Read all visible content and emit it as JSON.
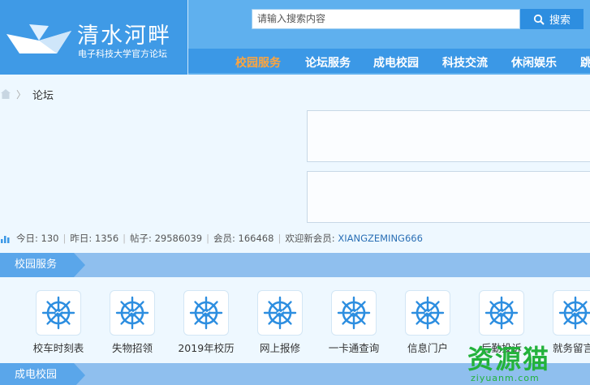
{
  "header": {
    "site_title": "清水河畔",
    "site_subtitle": "电子科技大学官方论坛",
    "search_placeholder": "请输入搜索内容",
    "search_button": "搜索"
  },
  "nav": {
    "items": [
      "校园服务",
      "论坛服务",
      "成电校园",
      "科技交流",
      "休闲娱乐",
      "跳"
    ],
    "active_index": 0
  },
  "breadcrumb": {
    "current": "论坛"
  },
  "stats": {
    "today_label": "今日:",
    "today": "130",
    "yesterday_label": "昨日:",
    "yesterday": "1356",
    "posts_label": "帖子:",
    "posts": "29586039",
    "members_label": "会员:",
    "members": "166468",
    "welcome_label": "欢迎新会员:",
    "new_member": "XIANGZEMING666"
  },
  "sections": [
    {
      "title": "校园服务",
      "items": [
        "校车时刻表",
        "失物招领",
        "2019年校历",
        "网上报修",
        "一卡通查询",
        "信息门户",
        "后勤投诉",
        "就务留言"
      ]
    },
    {
      "title": "成电校园"
    }
  ],
  "colors": {
    "header_bg": "#5fb0ee",
    "logo_bg": "#3f9ae6",
    "nav_active": "#ffa53d",
    "section_tab": "#5aa6ea",
    "icon_blue": "#2d8ee0"
  },
  "watermark": {
    "text": "资源猫",
    "sub": "ziyuanm.com"
  }
}
